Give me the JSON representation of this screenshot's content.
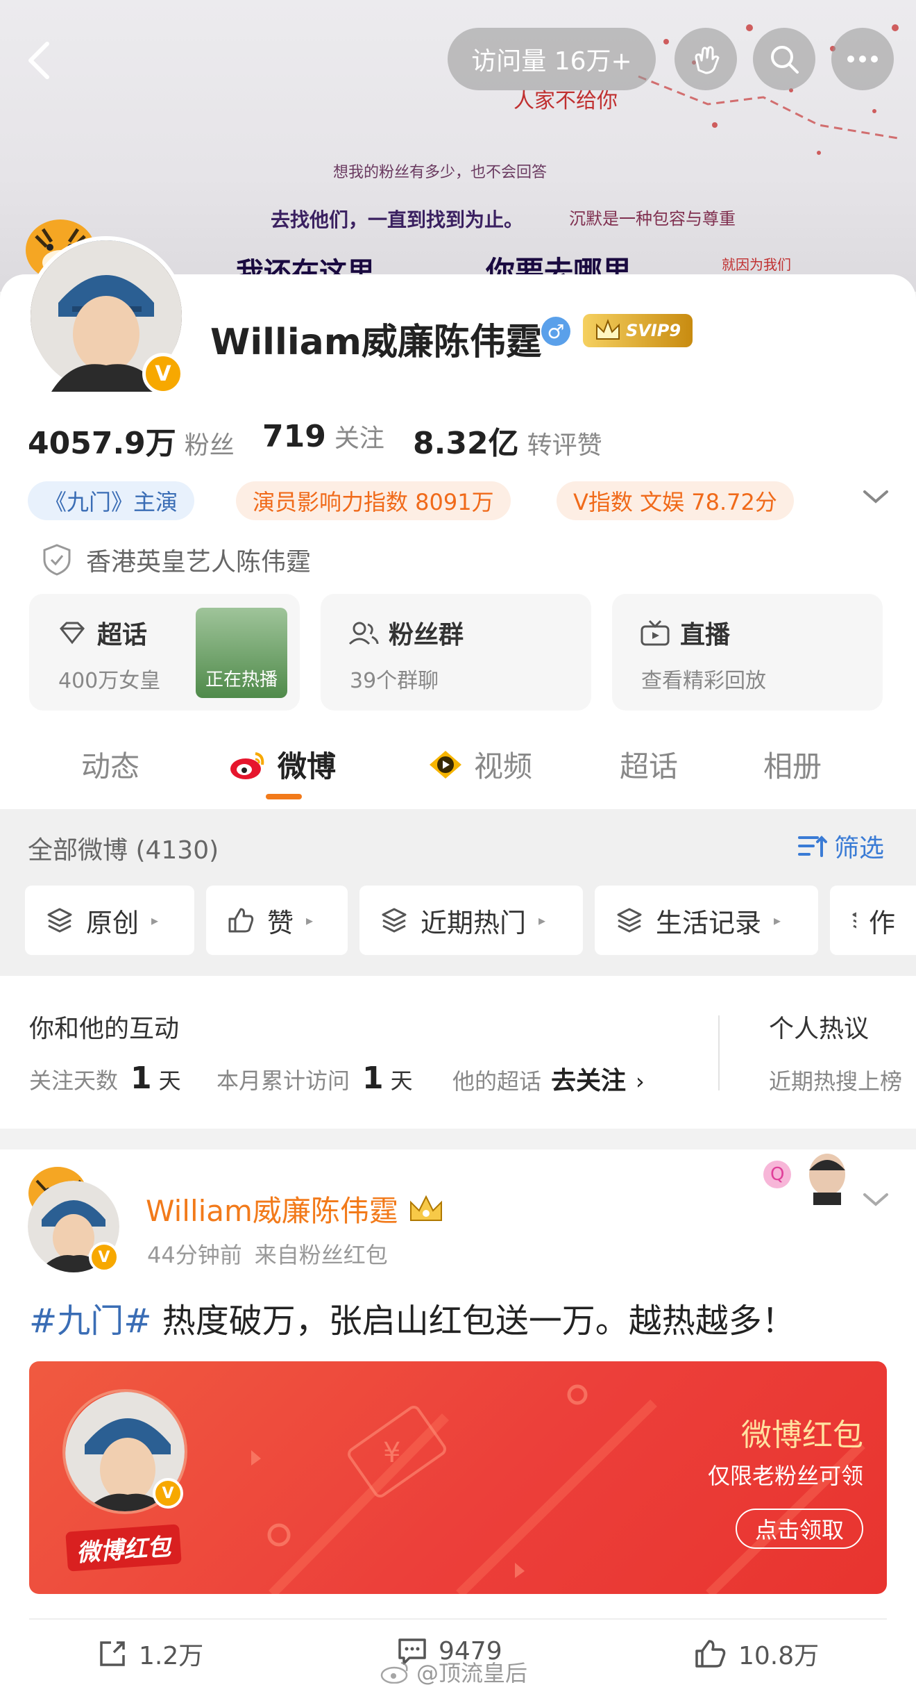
{
  "topbar": {
    "visits": "访问量 16万+"
  },
  "banner_text": [
    "人家不给你",
    "想我的粉丝有多少，也不会回答",
    "去找他们，一直到找到为止。",
    "我还在这里",
    "你要去哪里",
    "沉默是一种包容与尊重",
    "就因为我们"
  ],
  "profile": {
    "name": "William威廉陈伟霆",
    "gender": "♂",
    "svip": "SVIP9",
    "stats": [
      {
        "value": "4057.9万",
        "label": "粉丝"
      },
      {
        "value": "719",
        "label": "关注"
      },
      {
        "value": "8.32亿",
        "label": "转评赞"
      }
    ],
    "tags": [
      "《九门》主演",
      "演员影响力指数 8091万",
      "V指数 文娱 78.72分"
    ],
    "verified": "香港英皇艺人陈伟霆",
    "features": [
      {
        "title": "超话",
        "sub": "400万女皇",
        "thumb": "正在热播"
      },
      {
        "title": "粉丝群",
        "sub": "39个群聊"
      },
      {
        "title": "直播",
        "sub": "查看精彩回放"
      }
    ]
  },
  "tabs": [
    "动态",
    "微博",
    "视频",
    "超话",
    "相册"
  ],
  "filters": {
    "title": "全部微博 (4130)",
    "filter_btn": "筛选",
    "chips": [
      "原创",
      "赞",
      "近期热门",
      "生活记录",
      "作"
    ]
  },
  "interaction": {
    "title": "你和他的互动",
    "days_label": "关注天数",
    "days_value": "1",
    "days_unit": "天",
    "visit_label": "本月累计访问",
    "visit_value": "1",
    "visit_unit": "天",
    "topic_label": "他的超话",
    "topic_action": "去关注",
    "side_title": "个人热议",
    "side_sub": "近期热搜上榜"
  },
  "post": {
    "author": "William威廉陈伟霆",
    "time": "44分钟前",
    "source": "来自粉丝红包",
    "hashtag": "#九门#",
    "text": " 热度破万，张启山红包送一万。越热越多！",
    "packet_title": "微博红包",
    "packet_sub": "仅限老粉丝可领",
    "packet_btn": "点击领取",
    "packet_logo": "微博红包",
    "reposts": "1.2万",
    "comments": "9479",
    "likes": "10.8万",
    "watermark": "@顶流皇后"
  },
  "colors": {
    "orange": "#f27a1a",
    "blue_tag_bg": "#e8f1fc",
    "orange_tag_bg": "#fdeee4",
    "red": "#ec3f3a"
  }
}
